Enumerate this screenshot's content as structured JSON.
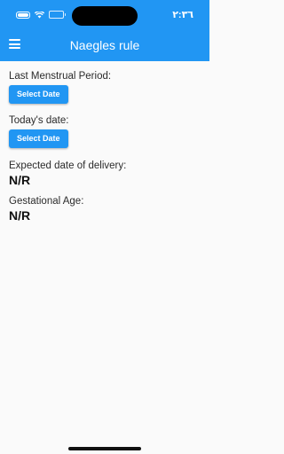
{
  "status_bar": {
    "time": "٢:٣٦"
  },
  "app_bar": {
    "title": "Naegles rule",
    "menu_icon": "menu-icon"
  },
  "lmp": {
    "label": "Last Menstrual Period:",
    "button_label": "Select Date"
  },
  "today": {
    "label": "Today's date:",
    "button_label": "Select Date"
  },
  "edd": {
    "label": "Expected date of delivery:",
    "value": "N/R"
  },
  "ga": {
    "label": "Gestational Age:",
    "value": "N/R"
  },
  "colors": {
    "primary": "#2196f3",
    "background": "#fafafa"
  }
}
